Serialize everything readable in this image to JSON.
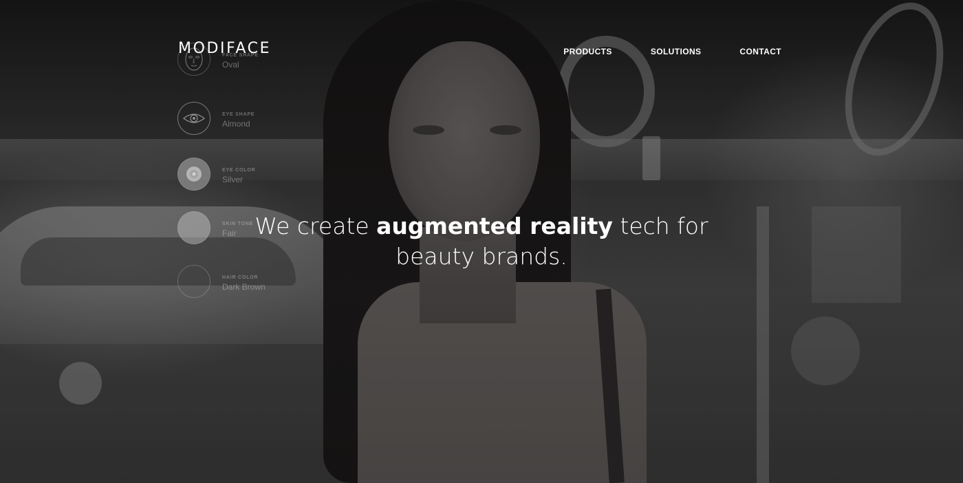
{
  "header": {
    "logo": "MODIFACE",
    "nav": [
      {
        "label": "PRODUCTS"
      },
      {
        "label": "SOLUTIONS"
      },
      {
        "label": "CONTACT"
      }
    ]
  },
  "analysis": {
    "items": [
      {
        "label": "FACE SHAPE",
        "value": "Oval",
        "icon": "face-outline-icon"
      },
      {
        "label": "EYE SHAPE",
        "value": "Almond",
        "icon": "eye-icon"
      },
      {
        "label": "EYE COLOR",
        "value": "Silver",
        "icon": "eye-color-icon"
      },
      {
        "label": "SKIN TONE",
        "value": "Fair",
        "icon": "skin-tone-swatch-icon"
      },
      {
        "label": "HAIR COLOR",
        "value": "Dark Brown",
        "icon": "hair-color-swatch-icon"
      }
    ]
  },
  "hero": {
    "prefix": "We create ",
    "emphasis": "augmented reality",
    "suffix_line1": " tech for",
    "line2": "beauty brands."
  },
  "colors": {
    "text": "#ffffff",
    "overlay": "#000000"
  }
}
